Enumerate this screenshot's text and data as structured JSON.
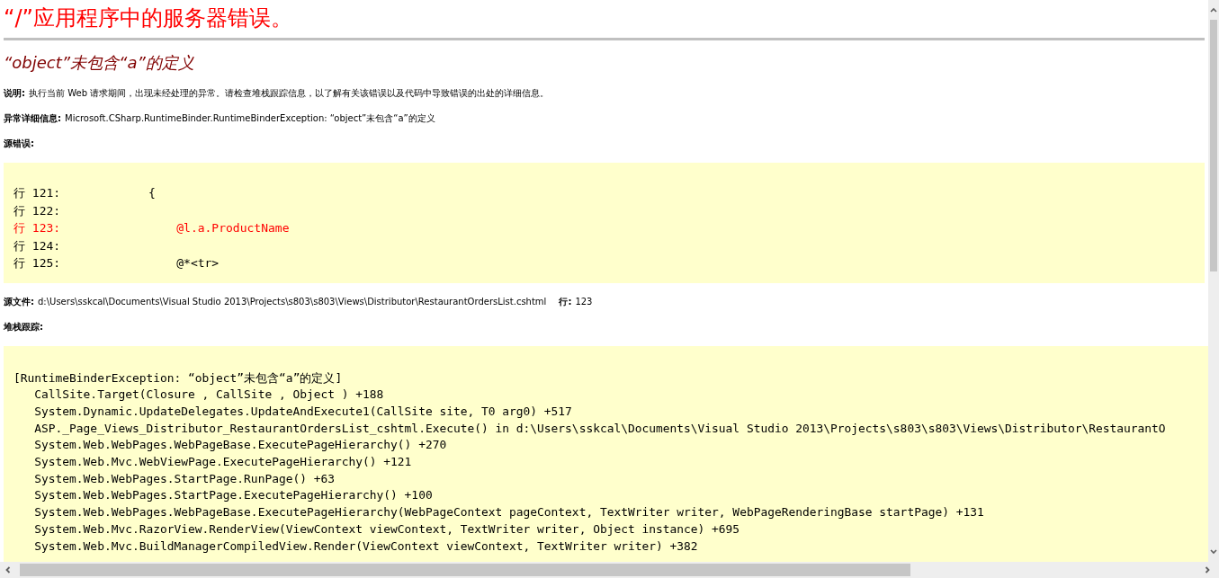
{
  "page": {
    "title": "“/”应用程序中的服务器错误。",
    "error_heading": "“object”未包含“a”的定义",
    "description": {
      "label": "说明:",
      "text": "执行当前 Web 请求期间，出现未经处理的异常。请检查堆栈跟踪信息，以了解有关该错误以及代码中导致错误的出处的详细信息。"
    },
    "exception_details": {
      "label": "异常详细信息:",
      "text": "Microsoft.CSharp.RuntimeBinder.RuntimeBinderException: “object”未包含“a”的定义"
    },
    "source_error": {
      "label": "源错误:",
      "lines": [
        {
          "number": "行 121:",
          "code": "            {",
          "highlighted": false
        },
        {
          "number": "行 122:",
          "highlighted": false
        },
        {
          "number": "行 123:",
          "code": "                @l.a.ProductName",
          "highlighted": true
        },
        {
          "number": "行 124:",
          "highlighted": false
        },
        {
          "number": "行 125:",
          "code": "                @*<tr>",
          "highlighted": false
        }
      ]
    },
    "source_file": {
      "label": "源文件:",
      "path": "d:\\Users\\sskcal\\Documents\\Visual Studio 2013\\Projects\\s803\\s803\\Views\\Distributor\\RestaurantOrdersList.cshtml",
      "line_label": "行:",
      "line": "123"
    },
    "stack_trace": {
      "label": "堆栈跟踪:",
      "lines": [
        "[RuntimeBinderException: “object”未包含“a”的定义]",
        "   CallSite.Target(Closure , CallSite , Object ) +188",
        "   System.Dynamic.UpdateDelegates.UpdateAndExecute1(CallSite site, T0 arg0) +517",
        "   ASP._Page_Views_Distributor_RestaurantOrdersList_cshtml.Execute() in d:\\Users\\sskcal\\Documents\\Visual Studio 2013\\Projects\\s803\\s803\\Views\\Distributor\\RestaurantO",
        "   System.Web.WebPages.WebPageBase.ExecutePageHierarchy() +270",
        "   System.Web.Mvc.WebViewPage.ExecutePageHierarchy() +121",
        "   System.Web.WebPages.StartPage.RunPage() +63",
        "   System.Web.WebPages.StartPage.ExecutePageHierarchy() +100",
        "   System.Web.WebPages.WebPageBase.ExecutePageHierarchy(WebPageContext pageContext, TextWriter writer, WebPageRenderingBase startPage) +131",
        "   System.Web.Mvc.RazorView.RenderView(ViewContext viewContext, TextWriter writer, Object instance) +695",
        "   System.Web.Mvc.BuildManagerCompiledView.Render(ViewContext viewContext, TextWriter writer) +382"
      ]
    }
  }
}
